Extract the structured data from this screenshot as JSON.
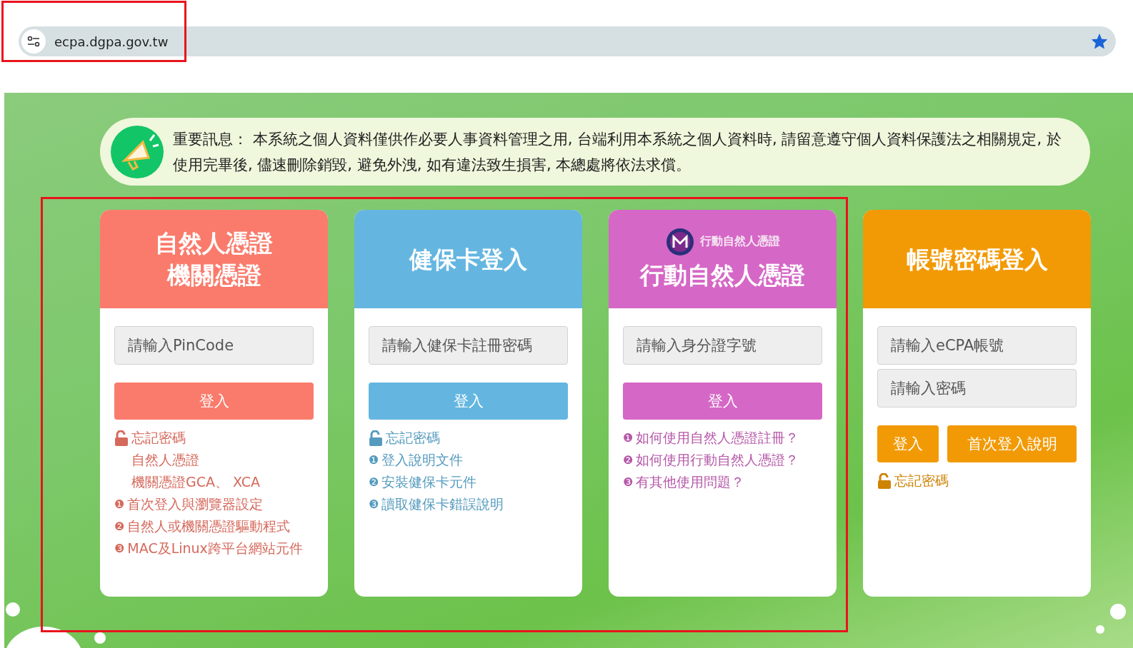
{
  "browser": {
    "url": "ecpa.dgpa.gov.tw",
    "bookmarked": true
  },
  "notice": {
    "text": "重要訊息： 本系統之個人資料僅供作必要人事資料管理之用, 台端利用本系統之個人資料時, 請留意遵守個人資料保護法之相關規定, 於使用完畢後, 儘速刪除銷毀, 避免外洩, 如有違法致生損害, 本總處將依法求償。"
  },
  "cards": [
    {
      "kind": "single",
      "color": "#fa7b6c",
      "title_lines": [
        "自然人憑證",
        "機關憑證"
      ],
      "fields": [
        {
          "placeholder": "請輸入PinCode"
        }
      ],
      "buttons": [
        "登入"
      ],
      "links": [
        {
          "kind": "lock",
          "text": "忘記密碼"
        },
        {
          "kind": "sub",
          "text": "自然人憑證"
        },
        {
          "kind": "sub",
          "text": "機關憑證GCA、 XCA"
        },
        {
          "kind": "numbered",
          "marker": "❶",
          "text": "首次登入與瀏覽器設定"
        },
        {
          "kind": "numbered",
          "marker": "❷",
          "text": "自然人或機關憑證驅動程式"
        },
        {
          "kind": "numbered",
          "marker": "❸",
          "text": "MAC及Linux跨平台網站元件"
        }
      ]
    },
    {
      "kind": "single",
      "color": "#64b6e0",
      "title_lines": [
        "健保卡登入"
      ],
      "fields": [
        {
          "placeholder": "請輸入健保卡註冊密碼"
        }
      ],
      "buttons": [
        "登入"
      ],
      "links": [
        {
          "kind": "lock",
          "text": "忘記密碼"
        },
        {
          "kind": "numbered",
          "marker": "❶",
          "text": "登入說明文件"
        },
        {
          "kind": "numbered",
          "marker": "❷",
          "text": "安裝健保卡元件"
        },
        {
          "kind": "numbered",
          "marker": "❸",
          "text": "讀取健保卡錯誤說明"
        }
      ]
    },
    {
      "kind": "single",
      "color": "#d567c6",
      "logo_text": "行動自然人憑證",
      "title_lines": [
        "行動自然人憑證"
      ],
      "fields": [
        {
          "placeholder": "請輸入身分證字號"
        }
      ],
      "buttons": [
        "登入"
      ],
      "links": [
        {
          "kind": "numbered",
          "marker": "❶",
          "text": "如何使用自然人憑證註冊？"
        },
        {
          "kind": "numbered",
          "marker": "❷",
          "text": "如何使用行動自然人憑證？"
        },
        {
          "kind": "numbered",
          "marker": "❸",
          "text": "有其他使用問題？"
        }
      ]
    },
    {
      "kind": "account",
      "color": "#f29a05",
      "title_lines": [
        "帳號密碼登入"
      ],
      "fields": [
        {
          "placeholder": "請輸入eCPA帳號"
        },
        {
          "placeholder": "請輸入密碼"
        }
      ],
      "buttons": [
        "登入",
        "首次登入說明"
      ],
      "links": [
        {
          "kind": "lock",
          "text": "忘記密碼"
        }
      ]
    }
  ]
}
